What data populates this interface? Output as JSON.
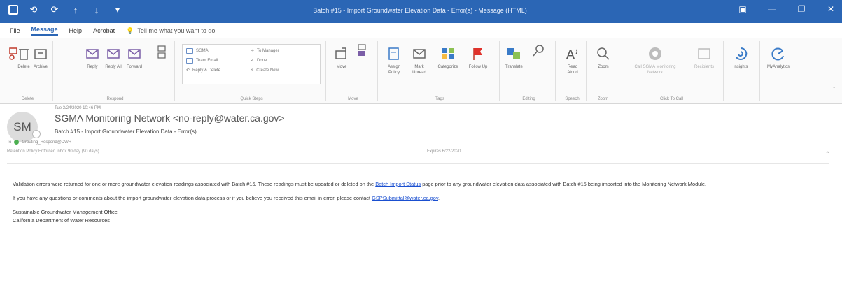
{
  "window": {
    "title": "Batch #15 - Import Groundwater Elevation Data - Error(s) - Message (HTML)",
    "qat_icons": [
      "save-icon",
      "undo-icon",
      "redo-icon",
      "up-arrow-icon",
      "down-arrow-icon",
      "customize-icon"
    ],
    "controls": [
      "ribbon-display-icon",
      "minimize-icon",
      "restore-icon",
      "close-icon"
    ]
  },
  "menu": {
    "file": "File",
    "message": "Message",
    "help": "Help",
    "acrobat": "Acrobat",
    "tell": "Tell me what you want to do"
  },
  "ribbon": {
    "delete_group": {
      "label": "Delete",
      "delete": "Delete",
      "archive": "Archive"
    },
    "respond_group": {
      "label": "Respond",
      "reply": "Reply",
      "reply_all": "Reply All",
      "forward": "Forward"
    },
    "quick_steps": {
      "label": "Quick Steps",
      "items": [
        "SGMA",
        "To Manager",
        "Team Email",
        "Done",
        "Reply & Delete",
        "Create New"
      ]
    },
    "move_group": {
      "label": "Move",
      "move": "Move"
    },
    "tags_group": {
      "label": "Tags",
      "assign_policy": "Assign Policy",
      "mark_unread": "Mark Unread",
      "categorize": "Categorize",
      "follow_up": "Follow Up"
    },
    "editing_group": {
      "label": "Editing",
      "translate": "Translate"
    },
    "speech_group": {
      "label": "Speech",
      "read_aloud": "Read Aloud"
    },
    "zoom_group": {
      "label": "Zoom",
      "zoom": "Zoom"
    },
    "click_to_call": {
      "label": "Click To Call",
      "call": "Call SGMA Monitoring Network",
      "recipients": "Recipients"
    },
    "insights": "Insights",
    "myanalytics": "MyAnalytics"
  },
  "message": {
    "avatar_initials": "SM",
    "sent": "Tue 3/24/2020 10:46 PM",
    "from": "SGMA Monitoring Network <no-reply@water.ca.gov>",
    "subject": "Batch #15 - Import Groundwater Elevation Data - Error(s)",
    "to_label": "To",
    "to_value": "Grouting_Respond@DWR",
    "retention": "Retention Policy   Enforced Inbox 90 day (90 days)",
    "expires": "Expires   6/22/2020",
    "body": {
      "p1_pre": "Validation errors were returned for one or more groundwater elevation readings associated with Batch #15. These readings must be updated or deleted on the",
      "p1_link": "Batch Import Status",
      "p1_post": "page prior to any groundwater elevation data associated with Batch #15 being imported into the Monitoring Network Module.",
      "p2_pre": "If you have any questions or comments about the import groundwater elevation data process or if you believe you received this email in error, please contact",
      "p2_link": "GSPSubmittal@water.ca.gov",
      "p2_post": ".",
      "sig1": "Sustainable Groundwater Management Office",
      "sig2": "California Department of Water Resources"
    }
  }
}
